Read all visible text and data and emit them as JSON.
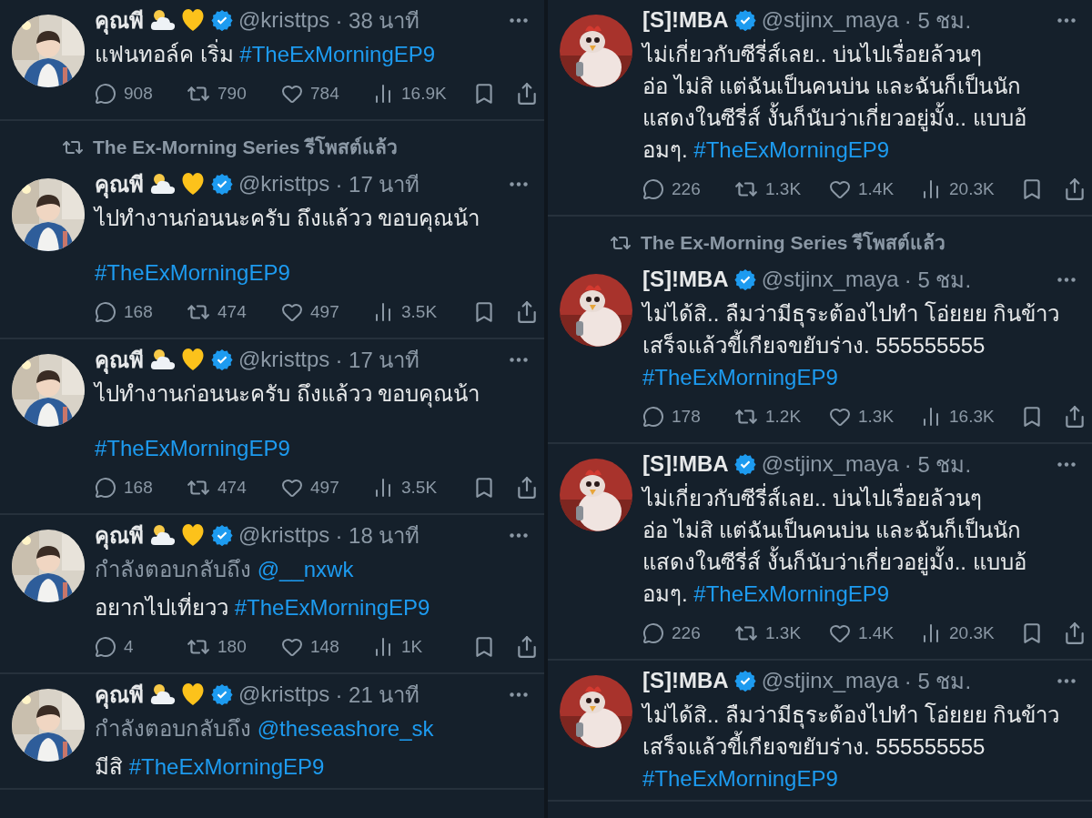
{
  "columns": [
    {
      "tweets": [
        {
          "name": "คุณพี",
          "name_emoji": true,
          "verified": true,
          "handle": "@kristtps",
          "time": "· 38 นาที",
          "paragraphs": [
            {
              "lines": [
                [
                  {
                    "kind": "text",
                    "text": "แฟนทอล์ค เริ่ม "
                  },
                  {
                    "kind": "link",
                    "text": "#TheExMorningEP9"
                  }
                ]
              ]
            }
          ],
          "stats": {
            "replies": "908",
            "reposts": "790",
            "likes": "784",
            "views": "16.9K"
          }
        },
        {
          "reposted_by": "The Ex-Morning Series รีโพสต์แล้ว",
          "name": "คุณพี",
          "name_emoji": true,
          "verified": true,
          "handle": "@kristtps",
          "time": "· 17 นาที",
          "paragraphs": [
            {
              "lines": [
                [
                  {
                    "kind": "text",
                    "text": "ไปทำงานก่อนนะครับ ถึงแล้วว ขอบคุณน้า"
                  }
                ]
              ]
            },
            {
              "lines": [
                [
                  {
                    "kind": "link",
                    "text": "#TheExMorningEP9"
                  }
                ]
              ]
            }
          ],
          "stats": {
            "replies": "168",
            "reposts": "474",
            "likes": "497",
            "views": "3.5K"
          }
        },
        {
          "name": "คุณพี",
          "name_emoji": true,
          "verified": true,
          "handle": "@kristtps",
          "time": "· 17 นาที",
          "paragraphs": [
            {
              "lines": [
                [
                  {
                    "kind": "text",
                    "text": "ไปทำงานก่อนนะครับ ถึงแล้วว ขอบคุณน้า"
                  }
                ]
              ]
            },
            {
              "lines": [
                [
                  {
                    "kind": "link",
                    "text": "#TheExMorningEP9"
                  }
                ]
              ]
            }
          ],
          "stats": {
            "replies": "168",
            "reposts": "474",
            "likes": "497",
            "views": "3.5K"
          }
        },
        {
          "name": "คุณพี",
          "name_emoji": true,
          "verified": true,
          "handle": "@kristtps",
          "time": "· 18 นาที",
          "reply_to": {
            "label": "กำลังตอบกลับถึง",
            "user": "@__nxwk"
          },
          "paragraphs": [
            {
              "lines": [
                [
                  {
                    "kind": "text",
                    "text": "อยากไปเที่ยวว "
                  },
                  {
                    "kind": "link",
                    "text": "#TheExMorningEP9"
                  }
                ]
              ]
            }
          ],
          "stats": {
            "replies": "4",
            "reposts": "180",
            "likes": "148",
            "views": "1K"
          }
        },
        {
          "name": "คุณพี",
          "name_emoji": true,
          "verified": true,
          "handle": "@kristtps",
          "time": "· 21 นาที",
          "reply_to": {
            "label": "กำลังตอบกลับถึง",
            "user": "@theseashore_sk"
          },
          "paragraphs": [
            {
              "lines": [
                [
                  {
                    "kind": "text",
                    "text": "มีสิ "
                  },
                  {
                    "kind": "link",
                    "text": "#TheExMorningEP9"
                  }
                ]
              ]
            }
          ]
        }
      ]
    },
    {
      "tweets": [
        {
          "name": "[S]!MBA",
          "name_emoji": false,
          "verified": true,
          "handle": "@stjinx_maya",
          "time": "· 5 ชม.",
          "paragraphs": [
            {
              "lines": [
                [
                  {
                    "kind": "text",
                    "text": "ไม่เกี่ยวกับซีรี่ส์เลย.. บ่นไปเรื่อยล้วนๆ"
                  }
                ],
                [
                  {
                    "kind": "text",
                    "text": "อ่อ ไม่สิ แต่ฉันเป็นคนบ่น และฉันก็เป็นนัก"
                  }
                ],
                [
                  {
                    "kind": "text",
                    "text": "แสดงในซีรี่ส์  งั้นก็นับว่าเกี่ยวอยู่มั้ง.. แบบอ้"
                  }
                ],
                [
                  {
                    "kind": "text",
                    "text": "อมๆ. "
                  },
                  {
                    "kind": "link",
                    "text": "#TheExMorningEP9"
                  }
                ]
              ]
            }
          ],
          "stats": {
            "replies": "226",
            "reposts": "1.3K",
            "likes": "1.4K",
            "views": "20.3K"
          }
        },
        {
          "reposted_by": "The Ex-Morning Series รีโพสต์แล้ว",
          "name": "[S]!MBA",
          "name_emoji": false,
          "verified": true,
          "handle": "@stjinx_maya",
          "time": "· 5 ชม.",
          "paragraphs": [
            {
              "lines": [
                [
                  {
                    "kind": "text",
                    "text": "ไม่ได้สิ.. ลืมว่ามีธุระต้องไปทำ โอ่ยยย กินข้าว"
                  }
                ],
                [
                  {
                    "kind": "text",
                    "text": "เสร็จแล้วขี้เกียจขยับร่าง. 555555555"
                  }
                ],
                [
                  {
                    "kind": "link",
                    "text": "#TheExMorningEP9"
                  }
                ]
              ]
            }
          ],
          "stats": {
            "replies": "178",
            "reposts": "1.2K",
            "likes": "1.3K",
            "views": "16.3K"
          }
        },
        {
          "name": "[S]!MBA",
          "name_emoji": false,
          "verified": true,
          "handle": "@stjinx_maya",
          "time": "· 5 ชม.",
          "paragraphs": [
            {
              "lines": [
                [
                  {
                    "kind": "text",
                    "text": "ไม่เกี่ยวกับซีรี่ส์เลย.. บ่นไปเรื่อยล้วนๆ"
                  }
                ],
                [
                  {
                    "kind": "text",
                    "text": "อ่อ ไม่สิ แต่ฉันเป็นคนบ่น และฉันก็เป็นนัก"
                  }
                ],
                [
                  {
                    "kind": "text",
                    "text": "แสดงในซีรี่ส์  งั้นก็นับว่าเกี่ยวอยู่มั้ง.. แบบอ้"
                  }
                ],
                [
                  {
                    "kind": "text",
                    "text": "อมๆ. "
                  },
                  {
                    "kind": "link",
                    "text": "#TheExMorningEP9"
                  }
                ]
              ]
            }
          ],
          "stats": {
            "replies": "226",
            "reposts": "1.3K",
            "likes": "1.4K",
            "views": "20.3K"
          }
        },
        {
          "name": "[S]!MBA",
          "name_emoji": false,
          "verified": true,
          "handle": "@stjinx_maya",
          "time": "· 5 ชม.",
          "paragraphs": [
            {
              "lines": [
                [
                  {
                    "kind": "text",
                    "text": "ไม่ได้สิ.. ลืมว่ามีธุระต้องไปทำ โอ่ยยย กินข้าว"
                  }
                ],
                [
                  {
                    "kind": "text",
                    "text": "เสร็จแล้วขี้เกียจขยับร่าง. 555555555"
                  }
                ],
                [
                  {
                    "kind": "link",
                    "text": "#TheExMorningEP9"
                  }
                ]
              ]
            }
          ]
        }
      ]
    }
  ]
}
